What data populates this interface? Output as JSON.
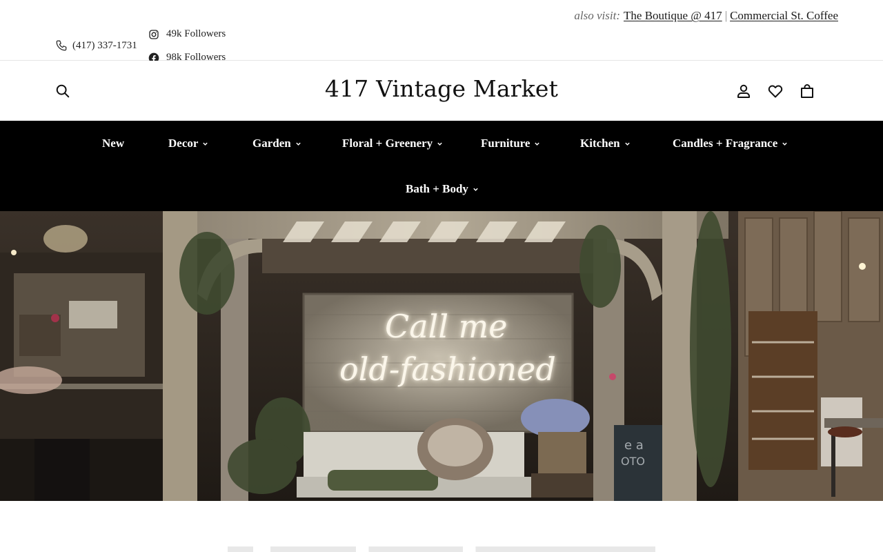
{
  "topbar": {
    "phone": "(417) 337-1731",
    "instagram_followers": "49k Followers",
    "facebook_followers": "98k Followers",
    "also_visit_label": "also visit:",
    "also_visit_links": [
      "The Boutique @ 417",
      "Commercial St. Coffee"
    ],
    "separator": "|"
  },
  "header": {
    "logo_text": "417 Vintage Market"
  },
  "nav": {
    "items": [
      {
        "label": "New",
        "has_dropdown": false
      },
      {
        "label": "Decor",
        "has_dropdown": true
      },
      {
        "label": "Garden",
        "has_dropdown": true
      },
      {
        "label": "Floral + Greenery",
        "has_dropdown": true
      },
      {
        "label": "Furniture",
        "has_dropdown": true
      },
      {
        "label": "Kitchen",
        "has_dropdown": true
      },
      {
        "label": "Candles + Fragrance",
        "has_dropdown": true
      },
      {
        "label": "Bath + Body",
        "has_dropdown": true
      }
    ]
  },
  "hero": {
    "neon_line_1": "Call me",
    "neon_line_2": "old-fashioned"
  },
  "icons": {
    "phone": "phone-icon",
    "instagram": "instagram-icon",
    "facebook": "facebook-icon",
    "search": "search-icon",
    "account": "user-icon",
    "wishlist": "heart-icon",
    "cart": "shopping-bag-icon",
    "dropdown": "chevron-down-icon"
  },
  "colors": {
    "nav_background": "#000000",
    "nav_text": "#ffffff",
    "page_background": "#ffffff",
    "text": "#1a1a1a"
  }
}
